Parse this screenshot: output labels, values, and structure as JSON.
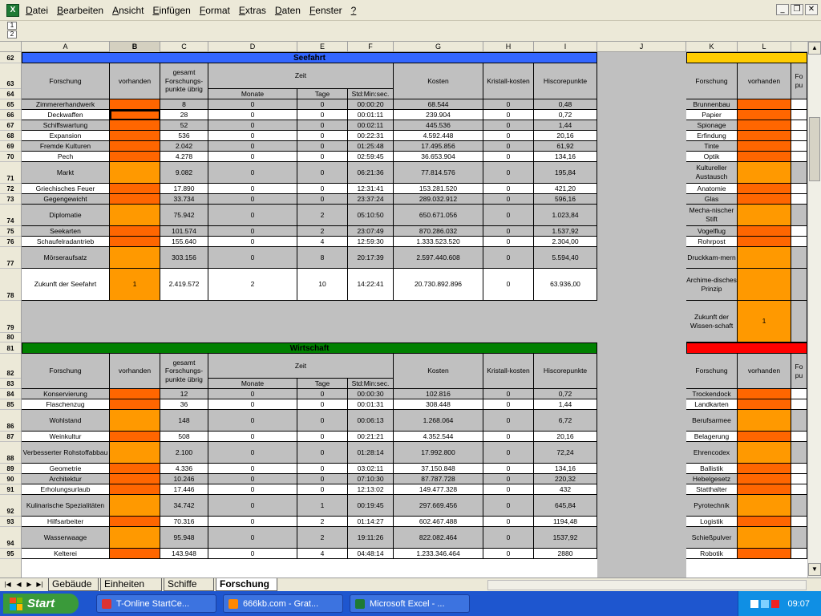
{
  "menubar": {
    "items": [
      {
        "label": "Datei"
      },
      {
        "label": "Bearbeiten"
      },
      {
        "label": "Ansicht"
      },
      {
        "label": "Einfügen"
      },
      {
        "label": "Format"
      },
      {
        "label": "Extras"
      },
      {
        "label": "Daten"
      },
      {
        "label": "Fenster"
      },
      {
        "label": "?"
      }
    ]
  },
  "window_controls": {
    "minimize": "_",
    "restore": "❐",
    "close": "✕"
  },
  "outline_levels": [
    "1",
    "2"
  ],
  "columns": [
    "A",
    "B",
    "C",
    "D",
    "E",
    "F",
    "G",
    "H",
    "I",
    "J",
    "K",
    "L"
  ],
  "row_numbers": [
    "62",
    "63",
    "64",
    "65",
    "66",
    "67",
    "68",
    "69",
    "70",
    "71",
    "72",
    "73",
    "74",
    "75",
    "76",
    "77",
    "78",
    "79",
    "80",
    "81",
    "82",
    "83",
    "84",
    "85",
    "86",
    "87",
    "88",
    "89",
    "90",
    "91",
    "92",
    "93",
    "94",
    "95"
  ],
  "colors": {
    "orange": "#ff6600",
    "light_orange": "#ff9900",
    "blue_header": "#3366ff",
    "green_header": "#008000",
    "yellow_header": "#ffcc00",
    "red_header": "#ff0000",
    "grey": "#c0c0c0"
  },
  "seefahrt": {
    "title": "Seefahrt",
    "headers": {
      "forschung": "Forschung",
      "vorhanden": "vorhanden",
      "gesamt": "gesamt Forschungs-punkte übrig",
      "zeit": "Zeit",
      "monate": "Monate",
      "tage": "Tage",
      "std": "Std:Min:sec.",
      "kosten": "Kosten",
      "kristall": "Kristall-kosten",
      "hiscore": "Hiscorepunkte"
    },
    "rows": [
      [
        "Zimmererhandwerk",
        "",
        "8",
        "0",
        "0",
        "00:00:20",
        "68.544",
        "0",
        "0,48"
      ],
      [
        "Deckwaffen",
        "",
        "28",
        "0",
        "0",
        "00:01:11",
        "239.904",
        "0",
        "0,72"
      ],
      [
        "Schiffswartung",
        "",
        "52",
        "0",
        "0",
        "00:02:11",
        "445.536",
        "0",
        "1,44"
      ],
      [
        "Expansion",
        "",
        "536",
        "0",
        "0",
        "00:22:31",
        "4.592.448",
        "0",
        "20,16"
      ],
      [
        "Fremde Kulturen",
        "",
        "2.042",
        "0",
        "0",
        "01:25:48",
        "17.495.856",
        "0",
        "61,92"
      ],
      [
        "Pech",
        "",
        "4.278",
        "0",
        "0",
        "02:59:45",
        "36.653.904",
        "0",
        "134,16"
      ],
      [
        "Markt",
        "",
        "9.082",
        "0",
        "0",
        "06:21:36",
        "77.814.576",
        "0",
        "195,84"
      ],
      [
        "Griechisches Feuer",
        "",
        "17.890",
        "0",
        "0",
        "12:31:41",
        "153.281.520",
        "0",
        "421,20"
      ],
      [
        "Gegengewicht",
        "",
        "33.734",
        "0",
        "0",
        "23:37:24",
        "289.032.912",
        "0",
        "596,16"
      ],
      [
        "Diplomatie",
        "",
        "75.942",
        "0",
        "2",
        "05:10:50",
        "650.671.056",
        "0",
        "1.023,84"
      ],
      [
        "Seekarten",
        "",
        "101.574",
        "0",
        "2",
        "23:07:49",
        "870.286.032",
        "0",
        "1.537,92"
      ],
      [
        "Schaufelradantrieb",
        "",
        "155.640",
        "0",
        "4",
        "12:59:30",
        "1.333.523.520",
        "0",
        "2.304,00"
      ],
      [
        "Mörseraufsatz",
        "",
        "303.156",
        "0",
        "8",
        "20:17:39",
        "2.597.440.608",
        "0",
        "5.594,40"
      ],
      [
        "Zukunft der Seefahrt",
        "1",
        "2.419.572",
        "2",
        "10",
        "14:22:41",
        "20.730.892.896",
        "0",
        "63.936,00"
      ]
    ]
  },
  "wirtschaft": {
    "title": "Wirtschaft",
    "headers": {
      "forschung": "Forschung",
      "vorhanden": "vorhanden",
      "gesamt": "gesamt Forschungs-punkte übrig",
      "zeit": "Zeit",
      "monate": "Monate",
      "tage": "Tage",
      "std": "Std:Min:sec.",
      "kosten": "Kosten",
      "kristall": "Kristall-kosten",
      "hiscore": "Hiscorepunkte"
    },
    "rows": [
      [
        "Konservierung",
        "",
        "12",
        "0",
        "0",
        "00:00:30",
        "102.816",
        "0",
        "0,72"
      ],
      [
        "Flaschenzug",
        "",
        "36",
        "0",
        "0",
        "00:01:31",
        "308.448",
        "0",
        "1,44"
      ],
      [
        "Wohlstand",
        "",
        "148",
        "0",
        "0",
        "00:06:13",
        "1.268.064",
        "0",
        "6,72"
      ],
      [
        "Weinkultur",
        "",
        "508",
        "0",
        "0",
        "00:21:21",
        "4.352.544",
        "0",
        "20,16"
      ],
      [
        "Verbesserter Rohstoffabbau",
        "",
        "2.100",
        "0",
        "0",
        "01:28:14",
        "17.992.800",
        "0",
        "72,24"
      ],
      [
        "Geometrie",
        "",
        "4.336",
        "0",
        "0",
        "03:02:11",
        "37.150.848",
        "0",
        "134,16"
      ],
      [
        "Architektur",
        "",
        "10.246",
        "0",
        "0",
        "07:10:30",
        "87.787.728",
        "0",
        "220,32"
      ],
      [
        "Erholungsurlaub",
        "",
        "17.446",
        "0",
        "0",
        "12:13:02",
        "149.477.328",
        "0",
        "432"
      ],
      [
        "Kulinarische Spezialitäten",
        "",
        "34.742",
        "0",
        "1",
        "00:19:45",
        "297.669.456",
        "0",
        "645,84"
      ],
      [
        "Hilfsarbeiter",
        "",
        "70.316",
        "0",
        "2",
        "01:14:27",
        "602.467.488",
        "0",
        "1194,48"
      ],
      [
        "Wasserwaage",
        "",
        "95.948",
        "0",
        "2",
        "19:11:26",
        "822.082.464",
        "0",
        "1537,92"
      ],
      [
        "Kelterei",
        "",
        "143.948",
        "0",
        "4",
        "04:48:14",
        "1.233.346.464",
        "0",
        "2880"
      ]
    ]
  },
  "right_top": {
    "headers": {
      "forschung": "Forschung",
      "vorhanden": "vorhanden",
      "partial": "Fo pu"
    },
    "rows": [
      {
        "name": "Brunnenbau",
        "val": ""
      },
      {
        "name": "Papier",
        "val": ""
      },
      {
        "name": "Spionage",
        "val": ""
      },
      {
        "name": "Erfindung",
        "val": ""
      },
      {
        "name": "Tinte",
        "val": ""
      },
      {
        "name": "Optik",
        "val": ""
      },
      {
        "name": "Kultureller Austausch",
        "val": ""
      },
      {
        "name": "Anatomie",
        "val": ""
      },
      {
        "name": "Glas",
        "val": ""
      },
      {
        "name": "Mecha-nischer Stift",
        "val": ""
      },
      {
        "name": "Vogelflug",
        "val": ""
      },
      {
        "name": "Rohrpost",
        "val": ""
      },
      {
        "name": "Druckkam-mern",
        "val": ""
      },
      {
        "name": "Archime-disches Prinzip",
        "val": ""
      },
      {
        "name": "Zukunft der Wissen-schaft",
        "val": "1"
      }
    ],
    "partial_last": "1."
  },
  "right_bottom": {
    "headers": {
      "forschung": "Forschung",
      "vorhanden": "vorhanden",
      "partial": "Fo pu"
    },
    "rows": [
      {
        "name": "Trockendock"
      },
      {
        "name": "Landkarten"
      },
      {
        "name": "Berufsarmee"
      },
      {
        "name": "Belagerung"
      },
      {
        "name": "Ehrencodex"
      },
      {
        "name": "Ballistik"
      },
      {
        "name": "Hebelgesetz"
      },
      {
        "name": "Statthalter"
      },
      {
        "name": "Pyrotechnik"
      },
      {
        "name": "Logistik"
      },
      {
        "name": "Schießpulver"
      },
      {
        "name": "Robotik"
      }
    ]
  },
  "sheet_tabs": [
    {
      "label": "Gebäude",
      "active": false
    },
    {
      "label": "Einheiten",
      "active": false
    },
    {
      "label": "Schiffe",
      "active": false
    },
    {
      "label": "Forschung",
      "active": true
    }
  ],
  "taskbar": {
    "start": "Start",
    "tasks": [
      {
        "label": "T-Online StartCe..."
      },
      {
        "label": "666kb.com - Grat..."
      },
      {
        "label": "Microsoft Excel - ..."
      }
    ],
    "clock": "09:07"
  }
}
